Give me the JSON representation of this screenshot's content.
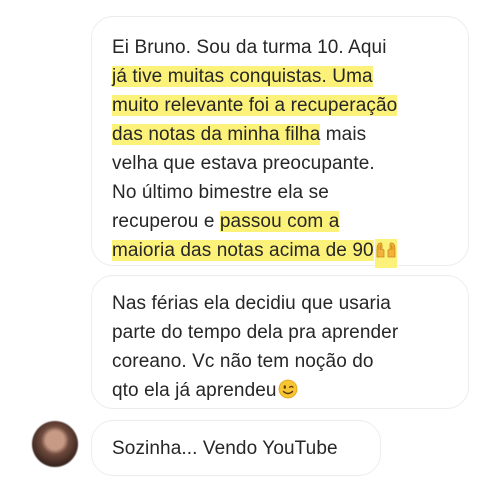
{
  "messages": [
    {
      "lines": [
        [
          {
            "text": "Ei Bruno. Sou da turma 10. Aqui",
            "highlight": false
          }
        ],
        [
          {
            "text": "já tive muitas conquistas. Uma",
            "highlight": true
          }
        ],
        [
          {
            "text": "muito relevante foi a recuperação",
            "highlight": true
          }
        ],
        [
          {
            "text": "das notas da minha filha",
            "highlight": true
          },
          {
            "text": " mais",
            "highlight": false
          }
        ],
        [
          {
            "text": "velha que estava preocupante.",
            "highlight": false
          }
        ],
        [
          {
            "text": "No último bimestre ela se",
            "highlight": false
          }
        ],
        [
          {
            "text": "recuperou e ",
            "highlight": false
          },
          {
            "text": "passou com a",
            "highlight": true
          }
        ],
        [
          {
            "text": "maioria das notas acima de 90",
            "highlight": true
          }
        ]
      ],
      "emoji": "raised-hands-icon"
    },
    {
      "lines": [
        "Nas férias ela decidiu que usaria",
        "parte do tempo dela pra aprender",
        "coreano. Vc não tem noção do",
        "qto ela já aprendeu"
      ],
      "emoji": "winking-face-icon"
    },
    {
      "text": "Sozinha... Vendo YouTube"
    }
  ],
  "colors": {
    "highlight": "#fcf27a",
    "bubble_border": "#ededed",
    "text": "#262626"
  }
}
